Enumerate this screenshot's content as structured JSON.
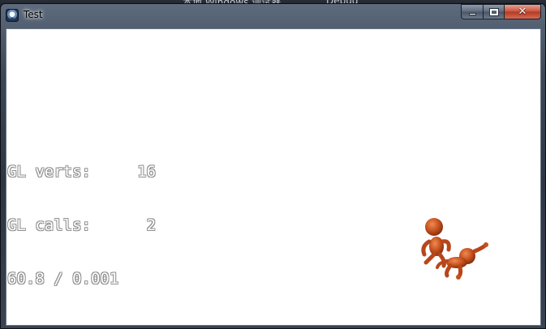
{
  "window": {
    "title": "Test",
    "minimize_glyph": "minimize",
    "maximize_glyph": "maximize",
    "close_glyph": "✕"
  },
  "background": {
    "partial_texts": [
      "本地 Windows 调试器",
      "Debug"
    ]
  },
  "stats": {
    "verts_label": "GL verts:",
    "verts_value": "16",
    "calls_label": "GL calls:",
    "calls_value": "2",
    "fps_line": "60.8 / 0.001"
  },
  "scene": {
    "model_color": "#c4501f",
    "model_highlight": "#f08a4e",
    "background_color": "#ffffff"
  },
  "icons": [
    "app-icon",
    "minimize-icon",
    "maximize-icon",
    "close-icon"
  ]
}
